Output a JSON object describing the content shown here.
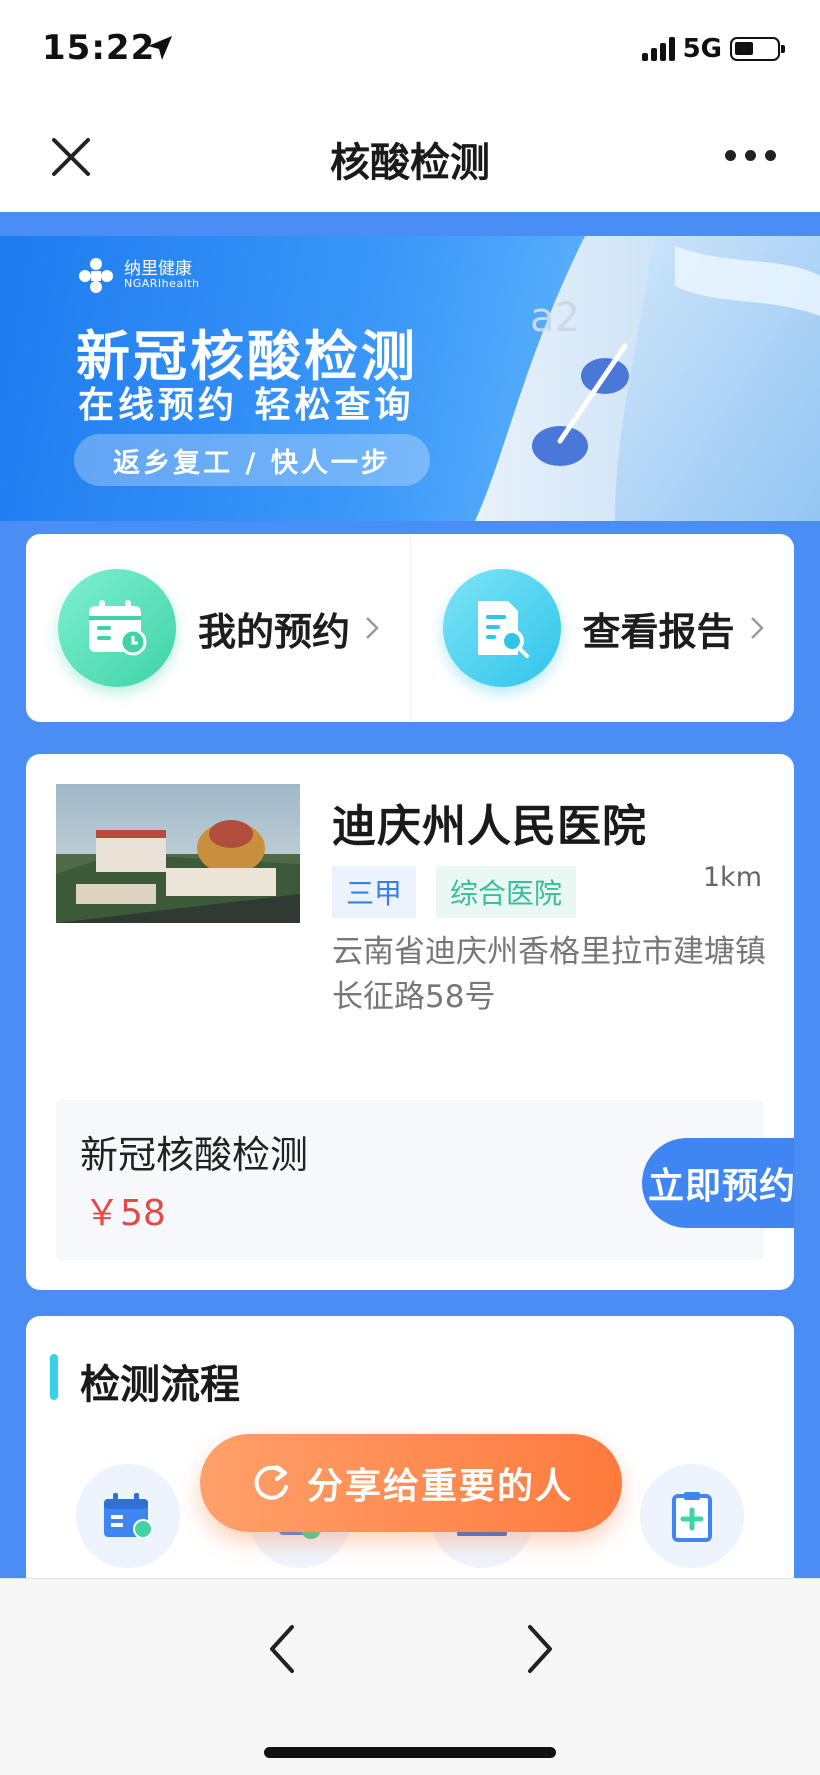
{
  "status_bar": {
    "time": "15:22",
    "network": "5G"
  },
  "nav": {
    "title": "核酸检测"
  },
  "banner": {
    "brand_cn": "纳里健康",
    "brand_en": "NGARIhealth",
    "title": "新冠核酸检测",
    "subtitle": "在线预约 轻松查询",
    "slogan": "返乡复工 / 快人一步"
  },
  "quick_actions": [
    {
      "label": "我的预约",
      "icon": "calendar-icon"
    },
    {
      "label": "查看报告",
      "icon": "report-search-icon"
    }
  ],
  "hospital": {
    "name": "迪庆州人民医院",
    "level_tag": "三甲",
    "type_tag": "综合医院",
    "distance": "1km",
    "address": "云南省迪庆州香格里拉市建塘镇长征路58号"
  },
  "service": {
    "name": "新冠核酸检测",
    "price": "￥58",
    "book_label": "立即预约"
  },
  "process": {
    "title": "检测流程"
  },
  "share": {
    "label": "分享给重要的人"
  },
  "colors": {
    "page_bg": "#4a8ef5",
    "primary": "#3f86f3",
    "price": "#e34a45",
    "share_start": "#ffa06a",
    "share_end": "#ff7a3d"
  }
}
